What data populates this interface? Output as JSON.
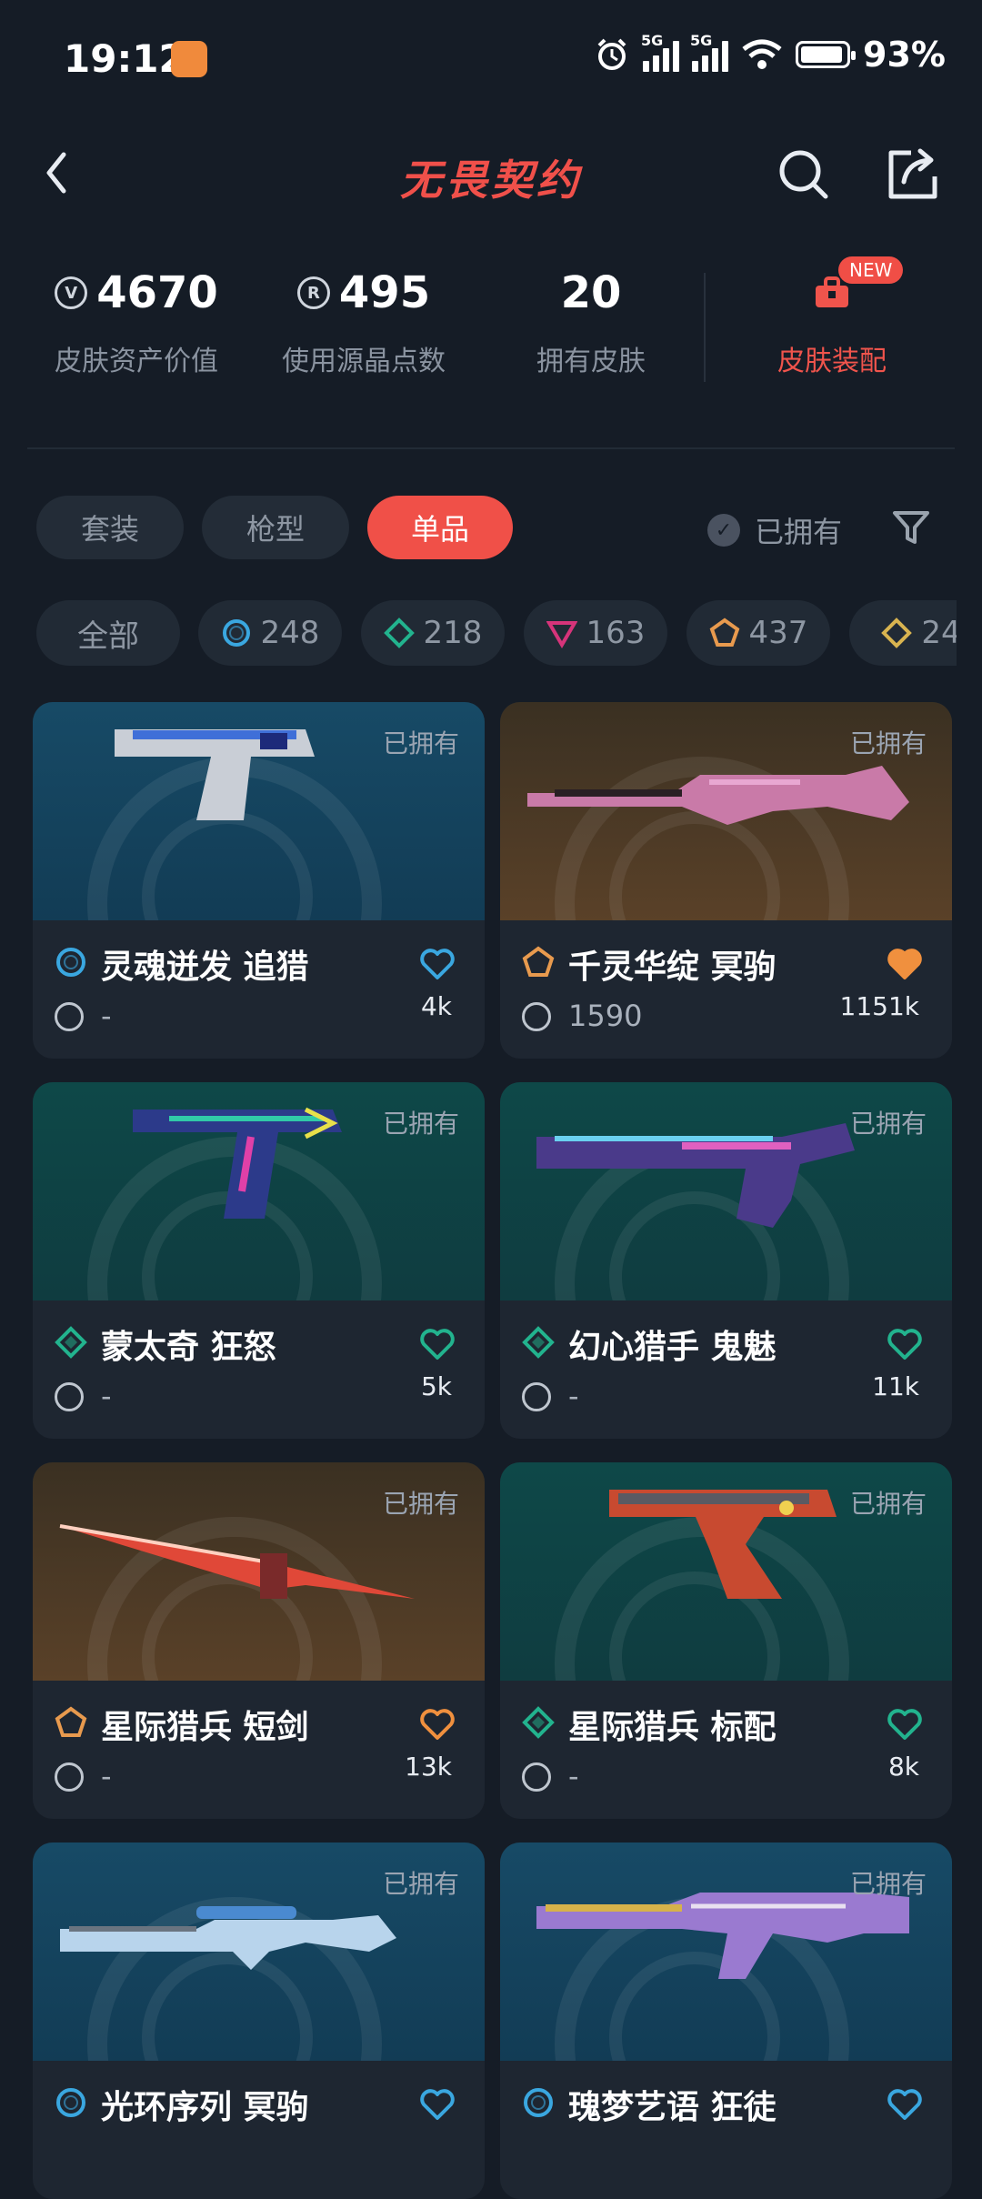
{
  "status_bar": {
    "time": "19:12",
    "net1": "5G",
    "net2": "5G",
    "battery_text": "93%",
    "battery_level": 0.93
  },
  "header": {
    "logo_text": "无畏契约"
  },
  "stats": [
    {
      "value": "4670",
      "label": "皮肤资产价值",
      "icon": "valor-coin-icon"
    },
    {
      "value": "495",
      "label": "使用源晶点数",
      "icon": "radianite-icon"
    },
    {
      "value": "20",
      "label": "拥有皮肤",
      "icon": ""
    }
  ],
  "equip": {
    "label": "皮肤装配",
    "badge": "NEW"
  },
  "tabs": [
    {
      "label": "套装",
      "active": false
    },
    {
      "label": "枪型",
      "active": false
    },
    {
      "label": "单品",
      "active": true
    }
  ],
  "owned_filter_label": "已拥有",
  "rarity_chips": [
    {
      "label": "全部",
      "icon": ""
    },
    {
      "label": "248",
      "icon": "select-tier-icon",
      "color": "#3aa7e0"
    },
    {
      "label": "218",
      "icon": "deluxe-tier-icon",
      "color": "#22b38e"
    },
    {
      "label": "163",
      "icon": "premium-tier-icon",
      "color": "#d6347a"
    },
    {
      "label": "437",
      "icon": "exclusive-tier-icon",
      "color": "#e89a4e"
    },
    {
      "label": "24",
      "icon": "ultra-tier-icon",
      "color": "#d9b450"
    }
  ],
  "cards": [
    {
      "owned": "已拥有",
      "name": "灵魂迸发 追猎",
      "price": "-",
      "likes": "4k",
      "tier": "select",
      "tier_color": "#3aa7e0",
      "heart_filled": false,
      "heart_color": "#3aa7e0",
      "bg": "blue"
    },
    {
      "owned": "已拥有",
      "name": "千灵华绽 冥驹",
      "price": "1590",
      "likes": "1151k",
      "tier": "exclusive",
      "tier_color": "#e89a4e",
      "heart_filled": true,
      "heart_color": "#f0903e",
      "bg": "gold"
    },
    {
      "owned": "已拥有",
      "name": "蒙太奇 狂怒",
      "price": "-",
      "likes": "5k",
      "tier": "deluxe",
      "tier_color": "#22b38e",
      "heart_filled": false,
      "heart_color": "#22b38e",
      "bg": "teal"
    },
    {
      "owned": "已拥有",
      "name": "幻心猎手 鬼魅",
      "price": "-",
      "likes": "11k",
      "tier": "deluxe",
      "tier_color": "#22b38e",
      "heart_filled": false,
      "heart_color": "#22b38e",
      "bg": "teal"
    },
    {
      "owned": "已拥有",
      "name": "星际猎兵 短剑",
      "price": "-",
      "likes": "13k",
      "tier": "exclusive",
      "tier_color": "#e89a4e",
      "heart_filled": false,
      "heart_color": "#f0903e",
      "bg": "gold"
    },
    {
      "owned": "已拥有",
      "name": "星际猎兵 标配",
      "price": "-",
      "likes": "8k",
      "tier": "deluxe",
      "tier_color": "#22b38e",
      "heart_filled": false,
      "heart_color": "#22b38e",
      "bg": "teal"
    },
    {
      "owned": "已拥有",
      "name": "光环序列 冥驹",
      "price": "",
      "likes": "",
      "tier": "select",
      "tier_color": "#3aa7e0",
      "heart_filled": false,
      "heart_color": "#3aa7e0",
      "bg": "blue"
    },
    {
      "owned": "已拥有",
      "name": "瑰梦艺语 狂徒",
      "price": "",
      "likes": "",
      "tier": "select",
      "tier_color": "#3aa7e0",
      "heart_filled": false,
      "heart_color": "#3aa7e0",
      "bg": "blue"
    }
  ]
}
